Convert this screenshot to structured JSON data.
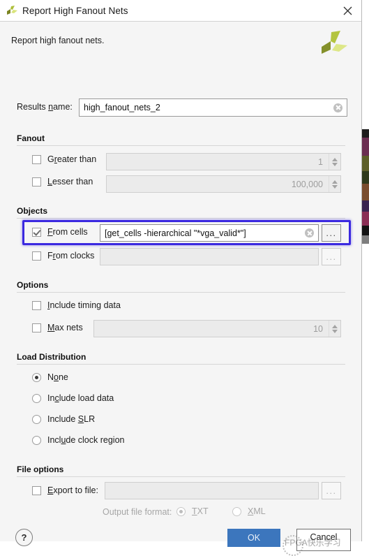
{
  "window": {
    "title": "Report High Fanout Nets",
    "app_icon": "xilinx-logo-icon",
    "close_icon": "close-icon"
  },
  "banner": {
    "description": "Report high fanout nets.",
    "logo": "xilinx-logo-icon"
  },
  "results": {
    "label": "Results ",
    "label_mnemonic": "n",
    "label_rest": "ame:",
    "value": "high_fanout_nets_2",
    "clear_icon": "clear-field-icon"
  },
  "fanout": {
    "heading": "Fanout",
    "greater_than": {
      "label_pre": "G",
      "label_mnemonic": "r",
      "label_post": "eater than",
      "checked": false,
      "value": "1",
      "enabled": false
    },
    "lesser_than": {
      "label_pre": "",
      "label_mnemonic": "L",
      "label_post": "esser than",
      "checked": false,
      "value": "100,000",
      "enabled": false
    }
  },
  "objects": {
    "heading": "Objects",
    "from_cells": {
      "label_pre": "",
      "label_mnemonic": "F",
      "label_post": "rom cells",
      "checked": true,
      "value": "[get_cells -hierarchical \"*vga_valid*\"]",
      "clear_icon": "clear-field-icon",
      "browse_label": "...",
      "highlighted": true,
      "highlight_color": "#3b29e0"
    },
    "from_clocks": {
      "label_pre": "F",
      "label_mnemonic": "r",
      "label_post": "om clocks",
      "checked": false,
      "value": "",
      "browse_label": "..."
    }
  },
  "options": {
    "heading": "Options",
    "include_timing_data": {
      "label_pre": "",
      "label_mnemonic": "I",
      "label_post": "nclude timing data",
      "checked": false
    },
    "max_nets": {
      "label_pre": "",
      "label_mnemonic": "M",
      "label_post": "ax nets",
      "checked": false,
      "value": "10",
      "enabled": false
    }
  },
  "load_distribution": {
    "heading": "Load Distribution",
    "items": [
      {
        "label_pre": "N",
        "label_mnemonic": "o",
        "label_post": "ne",
        "selected": true
      },
      {
        "label_pre": "In",
        "label_mnemonic": "c",
        "label_post": "lude load data",
        "selected": false
      },
      {
        "label_pre": "Include ",
        "label_mnemonic": "S",
        "label_post": "LR",
        "selected": false
      },
      {
        "label_pre": "Incl",
        "label_mnemonic": "u",
        "label_post": "de clock region",
        "selected": false
      }
    ]
  },
  "file_options": {
    "heading": "File options",
    "export_to_file": {
      "label_pre": "",
      "label_mnemonic": "E",
      "label_post": "xport to file:",
      "checked": false,
      "value": "",
      "browse_label": "..."
    },
    "output_file_format": {
      "label": "Output file format:",
      "enabled": false,
      "options": [
        {
          "label_pre": "",
          "label_mnemonic": "T",
          "label_post": "XT",
          "selected": true
        },
        {
          "label_pre": "",
          "label_mnemonic": "X",
          "label_post": "ML",
          "selected": false
        }
      ]
    }
  },
  "footer": {
    "help_label": "?",
    "ok_label": "OK",
    "cancel_label": "Cancel"
  },
  "watermark": {
    "text": "FPGA快乐学习"
  }
}
